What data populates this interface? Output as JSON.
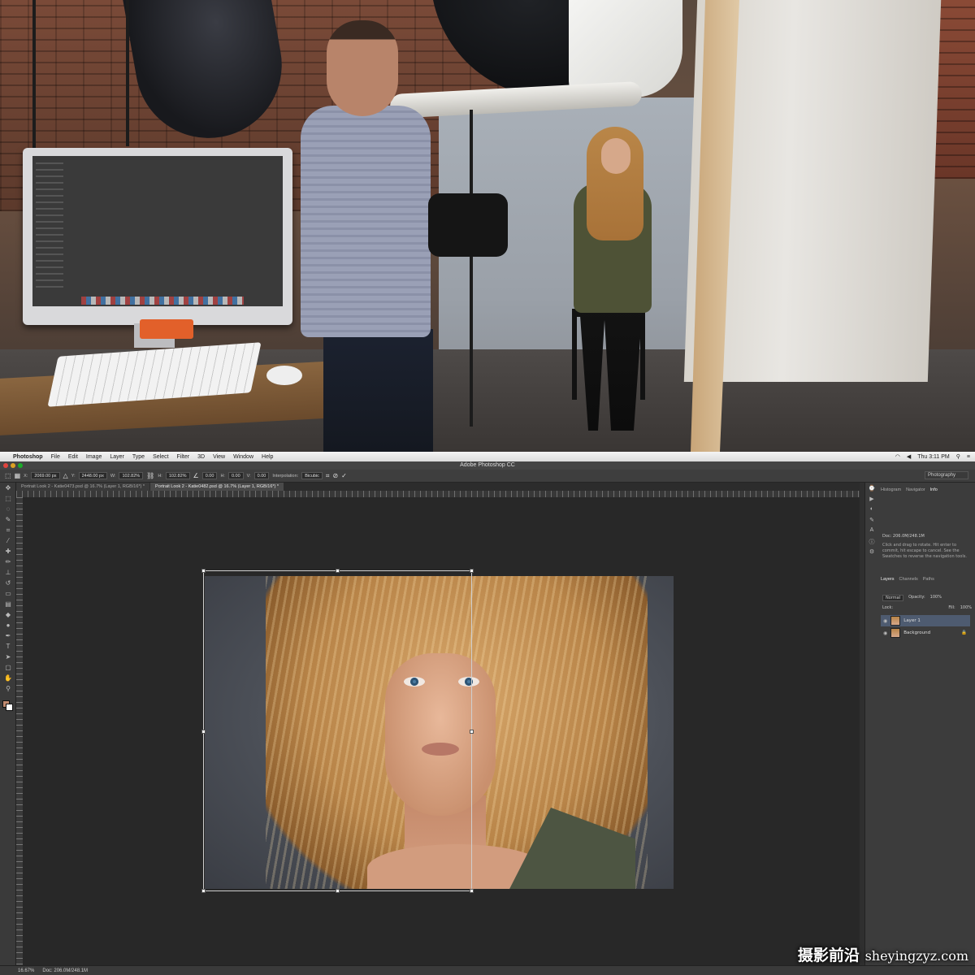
{
  "mac_menubar": {
    "apple": "",
    "app": "Photoshop",
    "items": [
      "File",
      "Edit",
      "Image",
      "Layer",
      "Type",
      "Select",
      "Filter",
      "3D",
      "View",
      "Window",
      "Help"
    ],
    "clock": "Thu 3:11 PM"
  },
  "window": {
    "title": "Adobe Photoshop CC",
    "workspace": "Photography"
  },
  "options_bar": {
    "x_label": "X:",
    "x_value": "2069.00 px",
    "y_label": "Y:",
    "y_value": "2448.00 px",
    "w_label": "W:",
    "w_value": "102.82%",
    "h_label": "H:",
    "h_value": "102.82%",
    "angle_value": "0.00",
    "hskew_label": "H:",
    "hskew_value": "0.00",
    "vskew_label": "V:",
    "vskew_value": "0.00",
    "interp_label": "Interpolation:",
    "interp_value": "Bicubic"
  },
  "tabs": [
    {
      "label": "Portrait Look 2 - Katie0473.psd @ 16.7% (Layer 1, RGB/16*) *",
      "active": false
    },
    {
      "label": "Portrait Look 2 - Katie0482.psd @ 16.7% (Layer 1, RGB/16*) *",
      "active": true
    }
  ],
  "right_panel": {
    "top_tabs": [
      "Histogram",
      "Navigator",
      "Info"
    ],
    "doc_line": "Doc: 206.0M/248.1M",
    "hint": "Click and drag to rotate. Hit enter to commit, hit escape to cancel. See the Swatches to reverse the navigation tools.",
    "layers_tabs": [
      "Layers",
      "Channels",
      "Paths"
    ],
    "blend_mode": "Normal",
    "opacity_label": "Opacity:",
    "opacity_value": "100%",
    "fill_label": "Fill:",
    "fill_value": "100%",
    "lock_label": "Lock:",
    "layers": [
      {
        "name": "Layer 1",
        "selected": true
      },
      {
        "name": "Background",
        "selected": false
      }
    ]
  },
  "status_bar": {
    "zoom": "16.67%",
    "doc": "Doc: 206.0M/248.1M"
  },
  "colors": {
    "foreground": "#c08a70",
    "background": "#ffffff",
    "accent": "#4e5b70"
  },
  "watermark": {
    "cn": "摄影前沿",
    "url": "sheyingzyz.com"
  }
}
